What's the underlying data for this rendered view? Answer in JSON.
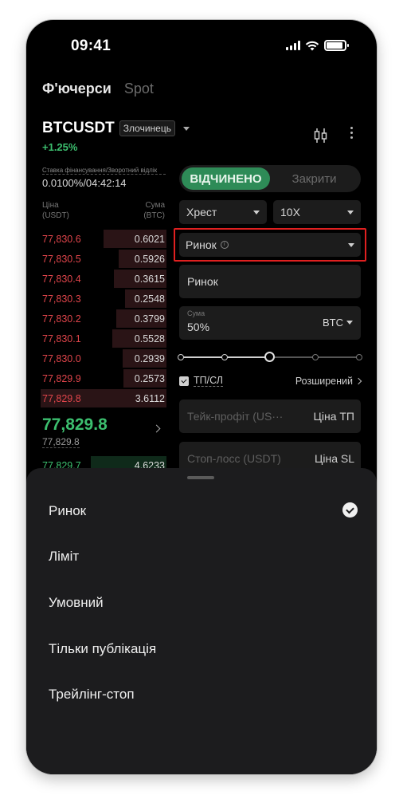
{
  "status": {
    "time": "09:41"
  },
  "tabs": [
    "Ф'ючерси",
    "Spot"
  ],
  "pair": {
    "name": "BTCUSDT",
    "badge": "Злочинець",
    "change": "+1.25%"
  },
  "funding": {
    "label": "Ставка фінансування/Зворотний відлік",
    "value": "0.0100%/04:42:14"
  },
  "orderbook": {
    "headers": {
      "price": "Ціна\n(USDT)",
      "qty": "Сума\n(BTC)"
    },
    "asks": [
      {
        "price": "77,830.6",
        "qty": "0.6021",
        "depth": 0.5
      },
      {
        "price": "77,830.5",
        "qty": "0.5926",
        "depth": 0.38
      },
      {
        "price": "77,830.4",
        "qty": "0.3615",
        "depth": 0.42
      },
      {
        "price": "77,830.3",
        "qty": "0.2548",
        "depth": 0.33
      },
      {
        "price": "77,830.2",
        "qty": "0.3799",
        "depth": 0.4
      },
      {
        "price": "77,830.1",
        "qty": "0.5528",
        "depth": 0.43
      },
      {
        "price": "77,830.0",
        "qty": "0.2939",
        "depth": 0.35
      },
      {
        "price": "77,829.9",
        "qty": "0.2573",
        "depth": 0.34
      },
      {
        "price": "77,829.8",
        "qty": "3.6112",
        "depth": 1.0
      }
    ],
    "last_price": "77,829.8",
    "mark_price": "77,829.8",
    "bids": [
      {
        "price": "77,829.7",
        "qty": "4.6233",
        "depth": 0.6
      }
    ]
  },
  "form": {
    "mode_on": "ВІДЧИНЕНО",
    "mode_off": "Закрити",
    "margin_mode": "Хрест",
    "leverage": "10X",
    "order_type": "Ринок",
    "price_field": "Ринок",
    "amount_label": "Сума",
    "amount_value": "50%",
    "amount_unit": "BTC",
    "slider_percent": 50,
    "tpsl_label": "ТП/СЛ",
    "advanced": "Розширений",
    "tp_placeholder": "Тейк-профіт (US···",
    "tp_unit": "Ціна ТП",
    "sl_placeholder": "Стоп-лосс (USDT)",
    "sl_unit": "Ціна SL"
  },
  "sheet": {
    "options": [
      "Ринок",
      "Ліміт",
      "Умовний",
      "Тільки публікація",
      "Трейлінг-стоп"
    ],
    "selected": "Ринок"
  },
  "colors": {
    "green": "#3cbf6f",
    "red": "#e0454b",
    "highlight": "#e02020"
  }
}
